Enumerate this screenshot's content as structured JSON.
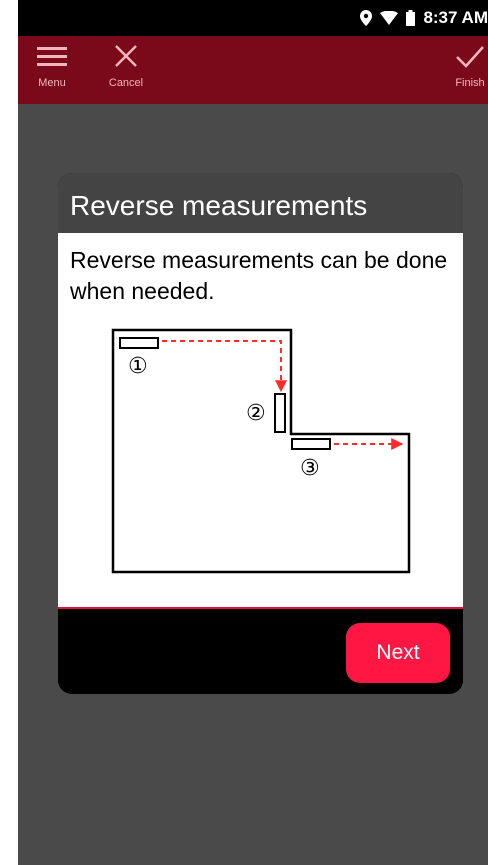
{
  "status": {
    "time": "8:37 AM"
  },
  "toolbar": {
    "menu_label": "Menu",
    "cancel_label": "Cancel",
    "finish_label": "Finish"
  },
  "dialog": {
    "title": "Reverse measurements",
    "body": "Reverse measurements can be done when needed.",
    "next_label": "Next",
    "step_markers": [
      "①",
      "②",
      "③"
    ]
  },
  "colors": {
    "toolbar_bg": "#7a0a19",
    "accent": "#ff1744",
    "arrow": "#ff2a2a",
    "backdrop": "#4a4a4a"
  }
}
